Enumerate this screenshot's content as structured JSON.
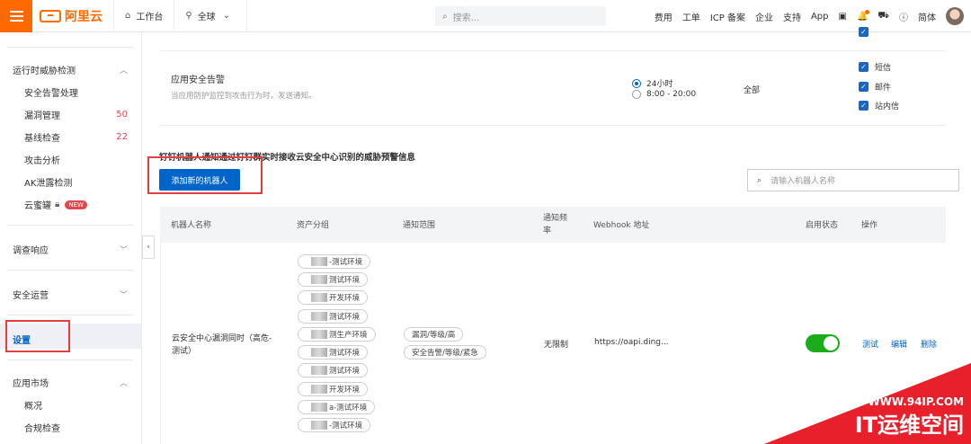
{
  "topbar": {
    "logo_text": "阿里云",
    "workbench": "工作台",
    "region": "全球",
    "search_placeholder": "搜索...",
    "links": [
      "费用",
      "工单",
      "ICP 备案",
      "企业",
      "支持",
      "App"
    ],
    "lang": "简体"
  },
  "sidebar": {
    "group_runtime": "运行时威胁检测",
    "items_runtime": [
      {
        "label": "安全告警处理",
        "count": ""
      },
      {
        "label": "漏洞管理",
        "count": "50"
      },
      {
        "label": "基线检查",
        "count": "22"
      },
      {
        "label": "攻击分析",
        "count": ""
      },
      {
        "label": "AK泄露检测",
        "count": ""
      },
      {
        "label": "云蜜罐",
        "count": ""
      }
    ],
    "new_badge": "NEW",
    "group_investigate": "调查响应",
    "group_operations": "安全运营",
    "settings": "设置",
    "group_market": "应用市场",
    "items_market": [
      "概况",
      "合规检查"
    ]
  },
  "alert_section": {
    "title": "应用安全告警",
    "desc": "当应用防护监控到攻击行为时，发送通知。",
    "radio_24h": "24小时",
    "radio_day": "8:00 - 20:00",
    "scope": "全部",
    "checkboxes": [
      "短信",
      "邮件",
      "站内信"
    ]
  },
  "dingtalk": {
    "title": "钉钉机器人通知通过钉钉群实时接收云安全中心识别的威胁预警信息",
    "add_button": "添加新的机器人",
    "search_placeholder": "请输入机器人名称"
  },
  "table": {
    "headers": [
      "机器人名称",
      "资产分组",
      "通知范围",
      "通知频率",
      "Webhook 地址",
      "启用状态",
      "操作"
    ],
    "row": {
      "name": "云安全中心漏洞同时（高危-测试）",
      "groups": [
        "-测试环境",
        "测试环境",
        "开发环境",
        "测试环境",
        "测生产环境",
        "测试环境",
        "测试环境",
        "开发环境",
        "a-测试环境",
        "-测试环境"
      ],
      "scopes": [
        "漏洞/等级/高",
        "安全告警/等级/紧急"
      ],
      "frequency": "无限制",
      "webhook": "https://oapi.ding...",
      "actions": [
        "测试",
        "编辑",
        "删除"
      ]
    }
  },
  "watermark": {
    "url": "WWW.94IP.COM",
    "brand": "IT运维空间"
  }
}
